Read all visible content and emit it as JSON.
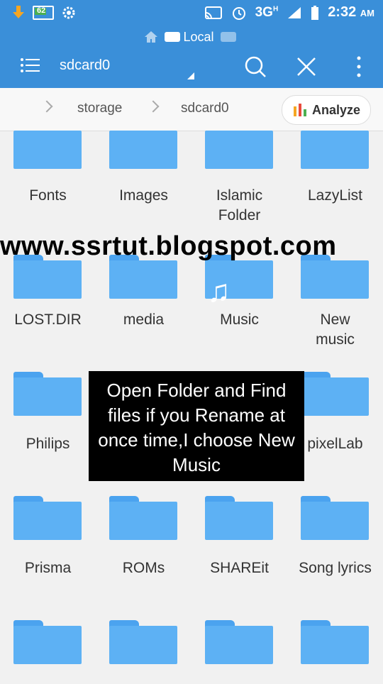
{
  "statusbar": {
    "battery_level": "62",
    "network": "3G",
    "network_sup": "H",
    "time": "2:32",
    "ampm": "AM"
  },
  "toolbar": {
    "tab_label": "Local",
    "title": "sdcard0"
  },
  "breadcrumb": {
    "items": [
      "storage",
      "sdcard0"
    ],
    "analyze_label": "Analyze"
  },
  "folders": [
    {
      "name": "Fonts"
    },
    {
      "name": "Images"
    },
    {
      "name": "Islamic Folder"
    },
    {
      "name": "LazyList"
    },
    {
      "name": "LOST.DIR"
    },
    {
      "name": "media"
    },
    {
      "name": "Music"
    },
    {
      "name": "New music"
    },
    {
      "name": "Philips"
    },
    {
      "name": ""
    },
    {
      "name": ""
    },
    {
      "name": "pixelLab"
    },
    {
      "name": "Prisma"
    },
    {
      "name": "ROMs"
    },
    {
      "name": "SHAREit"
    },
    {
      "name": "Song lyrics"
    }
  ],
  "overlay": {
    "watermark": "www.ssrtut.blogspot.com",
    "callout": "Open Folder and Find files if you Rename at once time,I choose New Music"
  },
  "colors": {
    "accent": "#3a8fd9",
    "folder": "#5db1f4"
  }
}
